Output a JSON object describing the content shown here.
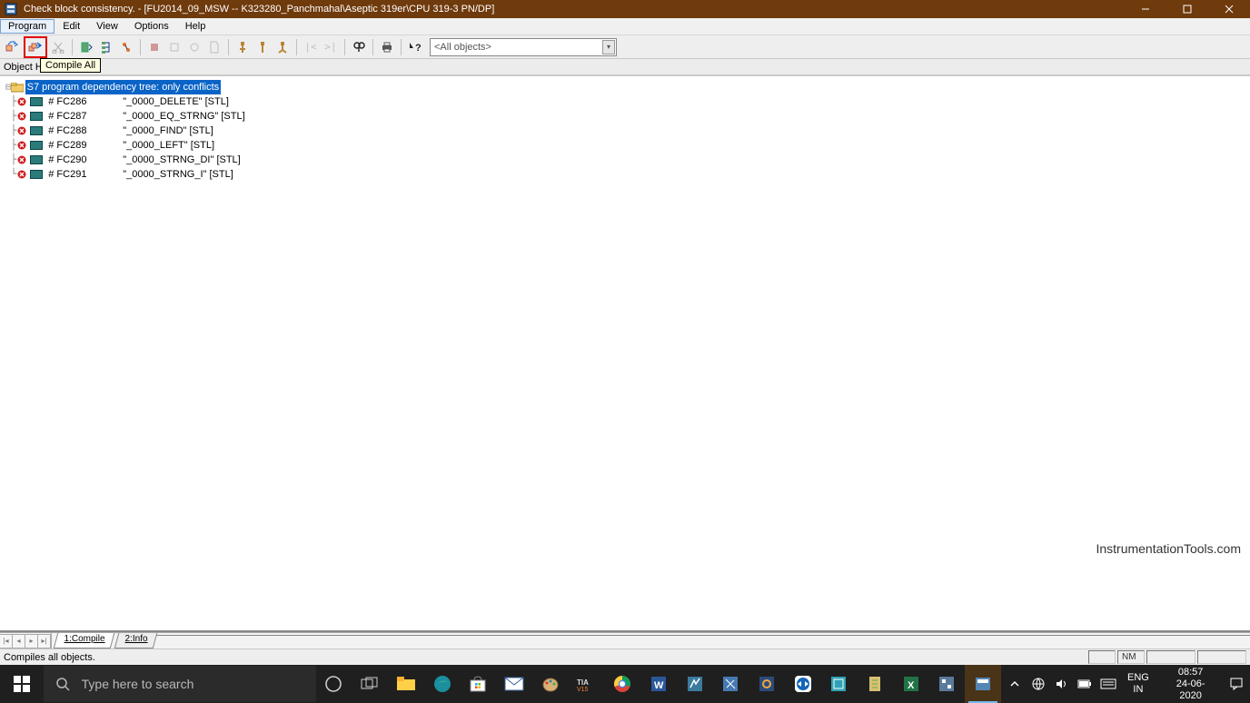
{
  "title": "Check block consistency. - [FU2014_09_MSW -- K323280_Panchmahal\\Aseptic 319er\\CPU 319-3 PN/DP]",
  "menus": {
    "m0": "Program",
    "m1": "Edit",
    "m2": "View",
    "m3": "Options",
    "m4": "Help"
  },
  "tooltip": "Compile All",
  "header_label": "Object Hi",
  "combo_value": "<All objects>",
  "tree_root": "S7 program dependency tree: only conflicts",
  "rows": [
    {
      "name": "# FC286",
      "desc": "\"_0000_DELETE\"  [STL]"
    },
    {
      "name": "# FC287",
      "desc": "\"_0000_EQ_STRNG\"  [STL]"
    },
    {
      "name": "# FC288",
      "desc": "\"_0000_FIND\"  [STL]"
    },
    {
      "name": "# FC289",
      "desc": "\"_0000_LEFT\"  [STL]"
    },
    {
      "name": "# FC290",
      "desc": "\"_0000_STRNG_DI\"  [STL]"
    },
    {
      "name": "# FC291",
      "desc": "\"_0000_STRNG_I\"  [STL]"
    }
  ],
  "tabs": {
    "t1": "1:Compile",
    "t2": "2:Info"
  },
  "status_text": "Compiles all objects.",
  "status_cell": "NM",
  "watermark": "InstrumentationTools.com",
  "search_placeholder": "Type here to search",
  "tray": {
    "lang1": "ENG",
    "lang2": "IN",
    "time": "08:57",
    "date": "24-06-2020"
  }
}
